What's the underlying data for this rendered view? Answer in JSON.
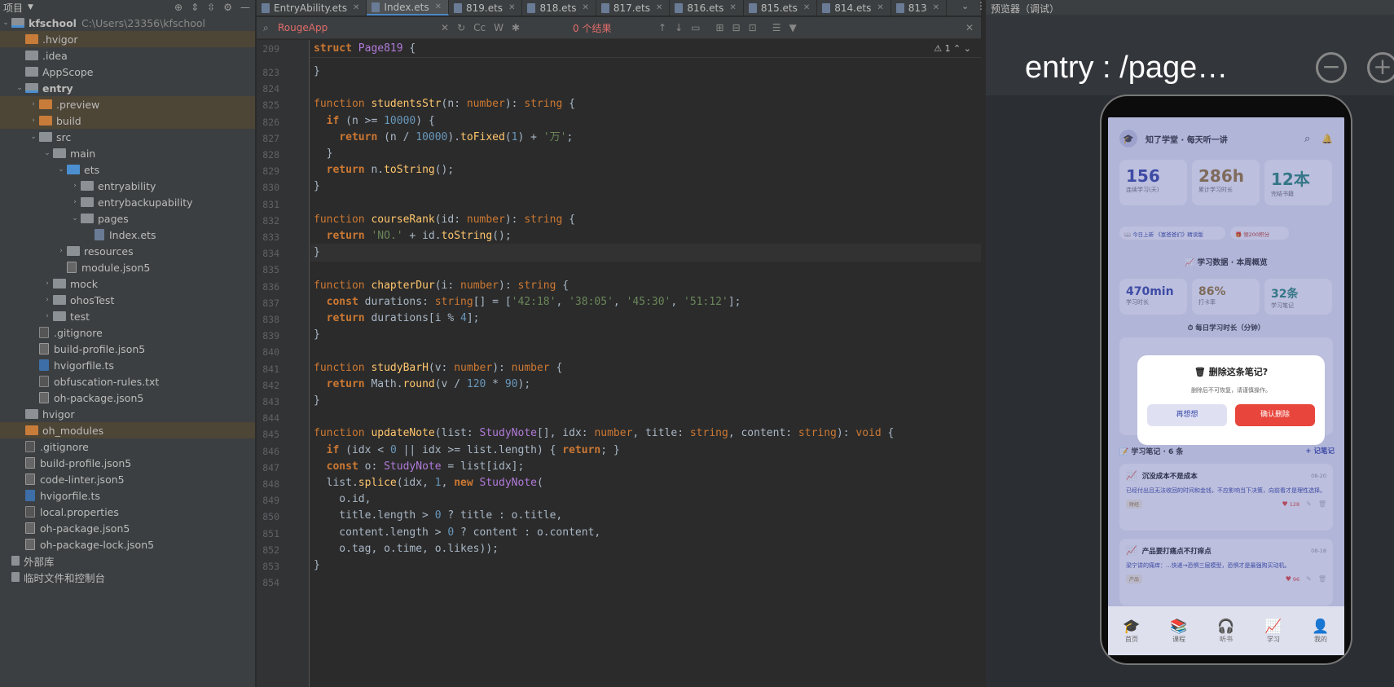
{
  "project": {
    "header": "项目",
    "root_name": "kfschool",
    "root_path": "C:\\Users\\23356\\kfschool",
    "tree": [
      {
        "label": "kfschool",
        "depth": 0,
        "kind": "root",
        "arrow": "open"
      },
      {
        "label": ".hvigor",
        "depth": 1,
        "kind": "orange",
        "hl": true
      },
      {
        "label": ".idea",
        "depth": 1,
        "kind": "plain"
      },
      {
        "label": "AppScope",
        "depth": 1,
        "kind": "plain"
      },
      {
        "label": "entry",
        "depth": 1,
        "kind": "mod",
        "arrow": "open",
        "bold": true
      },
      {
        "label": ".preview",
        "depth": 2,
        "kind": "orange",
        "arrow": "closed",
        "hl": true
      },
      {
        "label": "build",
        "depth": 2,
        "kind": "orange",
        "arrow": "closed",
        "hl": true
      },
      {
        "label": "src",
        "depth": 2,
        "kind": "plain",
        "arrow": "open"
      },
      {
        "label": "main",
        "depth": 3,
        "kind": "plain",
        "arrow": "open"
      },
      {
        "label": "ets",
        "depth": 4,
        "kind": "blue",
        "arrow": "open"
      },
      {
        "label": "entryability",
        "depth": 5,
        "kind": "plain",
        "arrow": "closed"
      },
      {
        "label": "entrybackupability",
        "depth": 5,
        "kind": "plain",
        "arrow": "closed"
      },
      {
        "label": "pages",
        "depth": 5,
        "kind": "plain",
        "arrow": "open"
      },
      {
        "label": "Index.ets",
        "depth": 6,
        "kind": "file-ets"
      },
      {
        "label": "resources",
        "depth": 4,
        "kind": "plain",
        "arrow": "closed"
      },
      {
        "label": "module.json5",
        "depth": 4,
        "kind": "file-json"
      },
      {
        "label": "mock",
        "depth": 3,
        "kind": "plain",
        "arrow": "closed"
      },
      {
        "label": "ohosTest",
        "depth": 3,
        "kind": "plain",
        "arrow": "closed"
      },
      {
        "label": "test",
        "depth": 3,
        "kind": "plain",
        "arrow": "closed"
      },
      {
        "label": ".gitignore",
        "depth": 2,
        "kind": "file"
      },
      {
        "label": "build-profile.json5",
        "depth": 2,
        "kind": "file-json"
      },
      {
        "label": "hvigorfile.ts",
        "depth": 2,
        "kind": "file-ts"
      },
      {
        "label": "obfuscation-rules.txt",
        "depth": 2,
        "kind": "file"
      },
      {
        "label": "oh-package.json5",
        "depth": 2,
        "kind": "file-json"
      },
      {
        "label": "hvigor",
        "depth": 1,
        "kind": "plain"
      },
      {
        "label": "oh_modules",
        "depth": 1,
        "kind": "orange",
        "hl": true
      },
      {
        "label": ".gitignore",
        "depth": 1,
        "kind": "file"
      },
      {
        "label": "build-profile.json5",
        "depth": 1,
        "kind": "file-json"
      },
      {
        "label": "code-linter.json5",
        "depth": 1,
        "kind": "file-json"
      },
      {
        "label": "hvigorfile.ts",
        "depth": 1,
        "kind": "file-ts"
      },
      {
        "label": "local.properties",
        "depth": 1,
        "kind": "file"
      },
      {
        "label": "oh-package.json5",
        "depth": 1,
        "kind": "file-json"
      },
      {
        "label": "oh-package-lock.json5",
        "depth": 1,
        "kind": "file-json"
      },
      {
        "label": "外部库",
        "depth": 0,
        "kind": "lib"
      },
      {
        "label": "临时文件和控制台",
        "depth": 0,
        "kind": "lib"
      }
    ]
  },
  "tabs": [
    {
      "label": "EntryAbility.ets",
      "active": false
    },
    {
      "label": "Index.ets",
      "active": true
    },
    {
      "label": "819.ets",
      "active": false
    },
    {
      "label": "818.ets",
      "active": false
    },
    {
      "label": "817.ets",
      "active": false
    },
    {
      "label": "816.ets",
      "active": false
    },
    {
      "label": "815.ets",
      "active": false
    },
    {
      "label": "814.ets",
      "active": false
    },
    {
      "label": "813",
      "active": false
    }
  ],
  "search": {
    "query": "RougeApp",
    "results": "0 个结果",
    "cc": "Cc",
    "w": "W"
  },
  "editor": {
    "sticky_line": "209",
    "warning_count": "1",
    "current_line": "834",
    "lines": [
      {
        "n": "823",
        "html": "}"
      },
      {
        "n": "824",
        "html": ""
      },
      {
        "n": "825",
        "html": "<span class='kw'>function</span> <span class='fn'>studentsStr</span>(n: <span class='t'>number</span>): <span class='t'>string</span> {"
      },
      {
        "n": "826",
        "html": "  <span class='k'>if</span> (n &gt;= <span class='n'>10000</span>) {"
      },
      {
        "n": "827",
        "html": "    <span class='k'>return</span> (n / <span class='n'>10000</span>).<span class='fn'>toFixed</span>(<span class='n'>1</span>) + <span class='s'>'万'</span>;"
      },
      {
        "n": "828",
        "html": "  }"
      },
      {
        "n": "829",
        "html": "  <span class='k'>return</span> n.<span class='fn'>toString</span>();"
      },
      {
        "n": "830",
        "html": "}"
      },
      {
        "n": "831",
        "html": ""
      },
      {
        "n": "832",
        "html": "<span class='kw'>function</span> <span class='fn'>courseRank</span>(id: <span class='t'>number</span>): <span class='t'>string</span> {"
      },
      {
        "n": "833",
        "html": "  <span class='k'>return</span> <span class='s'>'NO.'</span> + id.<span class='fn'>toString</span>();"
      },
      {
        "n": "834",
        "html": "}"
      },
      {
        "n": "835",
        "html": ""
      },
      {
        "n": "836",
        "html": "<span class='kw'>function</span> <span class='fn'>chapterDur</span>(i: <span class='t'>number</span>): <span class='t'>string</span> {"
      },
      {
        "n": "837",
        "html": "  <span class='k'>const</span> durations: <span class='t'>string</span>[] = [<span class='s'>'42:18'</span>, <span class='s'>'38:05'</span>, <span class='s'>'45:30'</span>, <span class='s'>'51:12'</span>];"
      },
      {
        "n": "838",
        "html": "  <span class='k'>return</span> durations[i % <span class='n'>4</span>];"
      },
      {
        "n": "839",
        "html": "}"
      },
      {
        "n": "840",
        "html": ""
      },
      {
        "n": "841",
        "html": "<span class='kw'>function</span> <span class='fn'>studyBarH</span>(v: <span class='t'>number</span>): <span class='t'>number</span> {"
      },
      {
        "n": "842",
        "html": "  <span class='k'>return</span> Math.<span class='fn'>round</span>(v / <span class='n'>120</span> * <span class='n'>90</span>);"
      },
      {
        "n": "843",
        "html": "}"
      },
      {
        "n": "844",
        "html": ""
      },
      {
        "n": "845",
        "html": "<span class='kw'>function</span> <span class='fn'>updateNote</span>(list: <span class='cls'>StudyNote</span>[], idx: <span class='t'>number</span>, title: <span class='t'>string</span>, content: <span class='t'>string</span>): <span class='t'>void</span> {"
      },
      {
        "n": "846",
        "html": "  <span class='k'>if</span> (idx &lt; <span class='n'>0</span> || idx &gt;= list.length) { <span class='k'>return</span>; }"
      },
      {
        "n": "847",
        "html": "  <span class='k'>const</span> o: <span class='cls'>StudyNote</span> = list[idx];"
      },
      {
        "n": "848",
        "html": "  list.<span class='fn'>splice</span>(idx, <span class='n'>1</span>, <span class='k'>new</span> <span class='cls'>StudyNote</span>("
      },
      {
        "n": "849",
        "html": "    o.id,"
      },
      {
        "n": "850",
        "html": "    title.length &gt; <span class='n'>0</span> ? title : o.title,"
      },
      {
        "n": "851",
        "html": "    content.length &gt; <span class='n'>0</span> ? content : o.content,"
      },
      {
        "n": "852",
        "html": "    o.tag, o.time, o.likes));"
      },
      {
        "n": "853",
        "html": "}"
      },
      {
        "n": "854",
        "html": ""
      }
    ]
  },
  "previewer": {
    "header": "预览器（调试）",
    "title": "entry : /page…",
    "app": {
      "app_title": "知了学堂 · 每天听一讲",
      "stats": [
        {
          "value": "156",
          "label": "连续学习(天)",
          "color": "#3b4aa8"
        },
        {
          "value": "286h",
          "label": "累计学习时长",
          "color": "#9a7a3a"
        },
        {
          "value": "12本",
          "label": "完结书籍",
          "color": "#2e8a7c"
        }
      ],
      "chip1": "📖 今日上新 《富爸爸们》精读版",
      "chip2": "🎁 领200积分",
      "section_title": "📈 学习数据 · 本周概览",
      "week_stats": [
        {
          "value": "470min",
          "label": "学习时长",
          "color": "#3b4aa8"
        },
        {
          "value": "86%",
          "label": "打卡率",
          "color": "#9a7a3a"
        },
        {
          "value": "32条",
          "label": "学习笔记",
          "color": "#2e8a7c"
        }
      ],
      "daily_title": "⏱ 每日学习时长（分钟）",
      "dialog": {
        "title": "🗑 删除这条笔记?",
        "desc": "删除后不可恢复，请谨慎操作。",
        "cancel": "再想想",
        "confirm": "确认删除"
      },
      "notes_title": "📝 学习笔记 · 6 条",
      "notes_add": "+ 记笔记",
      "notes": [
        {
          "title": "沉没成本不是成本",
          "date": "08-20",
          "body": "已经付出且无法收回的时间和金钱，不应影响当下决策，向前看才是理性选择。",
          "tag": "财经",
          "likes": "128"
        },
        {
          "title": "产品要打痛点不打痒点",
          "date": "08-18",
          "body": "梁宁讲的痛痒：...快递→恐惧三层模型，恐惧才是最强购买动机。",
          "tag": "产品",
          "likes": "96"
        }
      ],
      "tabbar": [
        {
          "label": "首页",
          "icon": "🎓"
        },
        {
          "label": "课程",
          "icon": "📚"
        },
        {
          "label": "听书",
          "icon": "🎧"
        },
        {
          "label": "学习",
          "icon": "📈"
        },
        {
          "label": "我的",
          "icon": "👤"
        }
      ]
    }
  }
}
